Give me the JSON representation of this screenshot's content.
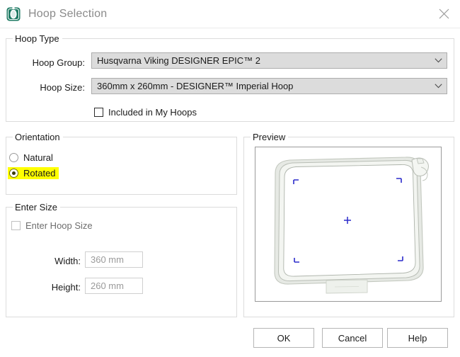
{
  "window": {
    "title": "Hoop Selection",
    "icon": "hoop-icon",
    "close_icon": "close-icon"
  },
  "hoop_type": {
    "legend": "Hoop Type",
    "hoop_group_label": "Hoop Group:",
    "hoop_group_value": "Husqvarna Viking DESIGNER EPIC™ 2",
    "hoop_size_label": "Hoop Size:",
    "hoop_size_value": "360mm x 260mm - DESIGNER™ Imperial Hoop",
    "included_checkbox_label": "Included in My Hoops",
    "included_checked": false
  },
  "orientation": {
    "legend": "Orientation",
    "options": [
      {
        "label": "Natural",
        "selected": false,
        "highlighted": false
      },
      {
        "label": "Rotated",
        "selected": true,
        "highlighted": true
      }
    ]
  },
  "enter_size": {
    "legend": "Enter Size",
    "enable_checkbox_label": "Enter Hoop Size",
    "enable_checked": false,
    "width_label": "Width:",
    "width_value": "360 mm",
    "height_label": "Height:",
    "height_value": "260 mm"
  },
  "preview": {
    "legend": "Preview",
    "hoop_fill": "#e6e9e4",
    "hoop_stroke": "#b9beb6",
    "marker_color": "#2b2bcc"
  },
  "buttons": {
    "ok": "OK",
    "cancel": "Cancel",
    "help": "Help"
  },
  "colors": {
    "accent_green": "#1e7a63",
    "highlight_yellow": "#ffff00",
    "combo_bg": "#dcdcdc"
  }
}
